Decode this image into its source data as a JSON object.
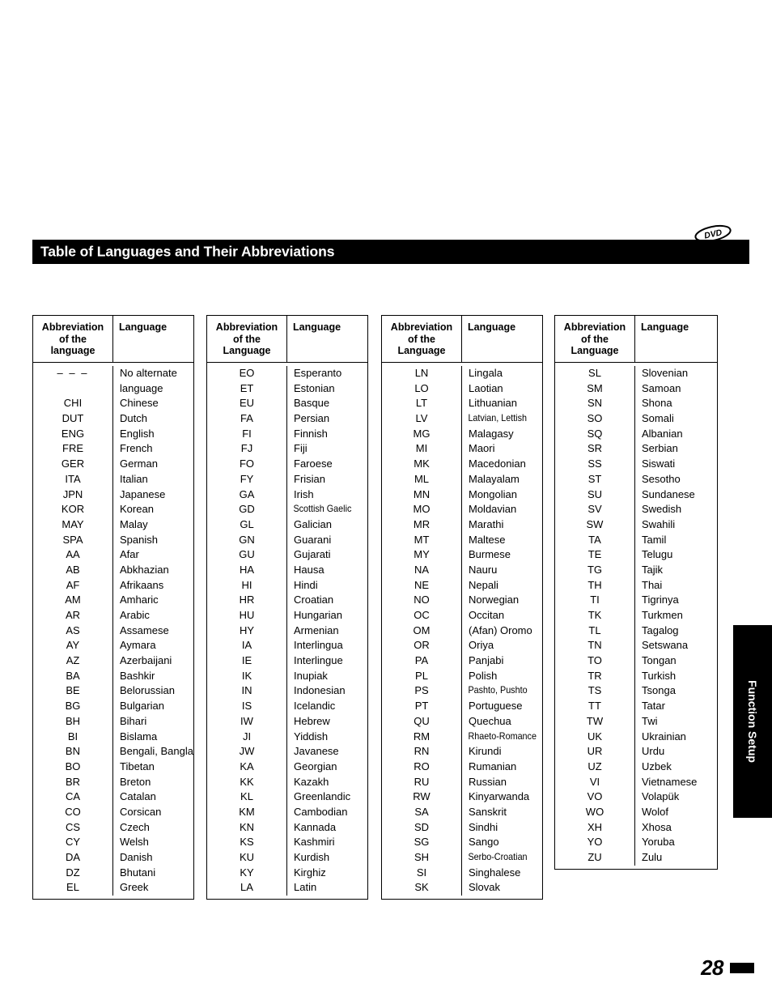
{
  "page": {
    "title": "Table of Languages and Their Abbreviations",
    "disc_badge": "DVD",
    "side_tab": "Function Setup",
    "page_number": "28"
  },
  "tables": [
    {
      "header": {
        "abbr": "Abbreviation\nof the\nlanguage",
        "lang": "Language"
      },
      "rows": [
        {
          "abbr": "– – –",
          "lang": "No alternate"
        },
        {
          "abbr": "",
          "lang": "language",
          "continuation": true
        },
        {
          "abbr": "CHI",
          "lang": "Chinese"
        },
        {
          "abbr": "DUT",
          "lang": "Dutch"
        },
        {
          "abbr": "ENG",
          "lang": "English"
        },
        {
          "abbr": "FRE",
          "lang": "French"
        },
        {
          "abbr": "GER",
          "lang": "German"
        },
        {
          "abbr": "ITA",
          "lang": "Italian"
        },
        {
          "abbr": "JPN",
          "lang": "Japanese"
        },
        {
          "abbr": "KOR",
          "lang": "Korean"
        },
        {
          "abbr": "MAY",
          "lang": "Malay"
        },
        {
          "abbr": "SPA",
          "lang": "Spanish"
        },
        {
          "abbr": "AA",
          "lang": "Afar"
        },
        {
          "abbr": "AB",
          "lang": "Abkhazian"
        },
        {
          "abbr": "AF",
          "lang": "Afrikaans"
        },
        {
          "abbr": "AM",
          "lang": "Amharic"
        },
        {
          "abbr": "AR",
          "lang": "Arabic"
        },
        {
          "abbr": "AS",
          "lang": "Assamese"
        },
        {
          "abbr": "AY",
          "lang": "Aymara"
        },
        {
          "abbr": "AZ",
          "lang": "Azerbaijani"
        },
        {
          "abbr": "BA",
          "lang": "Bashkir"
        },
        {
          "abbr": "BE",
          "lang": "Belorussian"
        },
        {
          "abbr": "BG",
          "lang": "Bulgarian"
        },
        {
          "abbr": "BH",
          "lang": "Bihari"
        },
        {
          "abbr": "BI",
          "lang": "Bislama"
        },
        {
          "abbr": "BN",
          "lang": "Bengali, Bangla"
        },
        {
          "abbr": "BO",
          "lang": "Tibetan"
        },
        {
          "abbr": "BR",
          "lang": "Breton"
        },
        {
          "abbr": "CA",
          "lang": "Catalan"
        },
        {
          "abbr": "CO",
          "lang": "Corsican"
        },
        {
          "abbr": "CS",
          "lang": "Czech"
        },
        {
          "abbr": "CY",
          "lang": "Welsh"
        },
        {
          "abbr": "DA",
          "lang": "Danish"
        },
        {
          "abbr": "DZ",
          "lang": "Bhutani"
        },
        {
          "abbr": "EL",
          "lang": "Greek"
        }
      ]
    },
    {
      "header": {
        "abbr": "Abbreviation\nof the\nLanguage",
        "lang": "Language"
      },
      "rows": [
        {
          "abbr": "EO",
          "lang": "Esperanto"
        },
        {
          "abbr": "ET",
          "lang": "Estonian"
        },
        {
          "abbr": "EU",
          "lang": "Basque"
        },
        {
          "abbr": "FA",
          "lang": "Persian"
        },
        {
          "abbr": "FI",
          "lang": "Finnish"
        },
        {
          "abbr": "FJ",
          "lang": "Fiji"
        },
        {
          "abbr": "FO",
          "lang": "Faroese"
        },
        {
          "abbr": "FY",
          "lang": "Frisian"
        },
        {
          "abbr": "GA",
          "lang": "Irish"
        },
        {
          "abbr": "GD",
          "lang": "Scottish Gaelic",
          "condensed": true
        },
        {
          "abbr": "GL",
          "lang": "Galician"
        },
        {
          "abbr": "GN",
          "lang": "Guarani"
        },
        {
          "abbr": "GU",
          "lang": "Gujarati"
        },
        {
          "abbr": "HA",
          "lang": "Hausa"
        },
        {
          "abbr": "HI",
          "lang": "Hindi"
        },
        {
          "abbr": "HR",
          "lang": "Croatian"
        },
        {
          "abbr": "HU",
          "lang": "Hungarian"
        },
        {
          "abbr": "HY",
          "lang": "Armenian"
        },
        {
          "abbr": "IA",
          "lang": "Interlingua"
        },
        {
          "abbr": "IE",
          "lang": "Interlingue"
        },
        {
          "abbr": "IK",
          "lang": "Inupiak"
        },
        {
          "abbr": "IN",
          "lang": "Indonesian"
        },
        {
          "abbr": "IS",
          "lang": "Icelandic"
        },
        {
          "abbr": "IW",
          "lang": "Hebrew"
        },
        {
          "abbr": "JI",
          "lang": "Yiddish"
        },
        {
          "abbr": "JW",
          "lang": "Javanese"
        },
        {
          "abbr": "KA",
          "lang": "Georgian"
        },
        {
          "abbr": "KK",
          "lang": "Kazakh"
        },
        {
          "abbr": "KL",
          "lang": "Greenlandic"
        },
        {
          "abbr": "KM",
          "lang": "Cambodian"
        },
        {
          "abbr": "KN",
          "lang": "Kannada"
        },
        {
          "abbr": "KS",
          "lang": "Kashmiri"
        },
        {
          "abbr": "KU",
          "lang": "Kurdish"
        },
        {
          "abbr": "KY",
          "lang": "Kirghiz"
        },
        {
          "abbr": "LA",
          "lang": "Latin"
        }
      ]
    },
    {
      "header": {
        "abbr": "Abbreviation\nof the\nLanguage",
        "lang": "Language"
      },
      "rows": [
        {
          "abbr": "LN",
          "lang": "Lingala"
        },
        {
          "abbr": "LO",
          "lang": "Laotian"
        },
        {
          "abbr": "LT",
          "lang": "Lithuanian"
        },
        {
          "abbr": "LV",
          "lang": "Latvian, Lettish",
          "condensed": true
        },
        {
          "abbr": "MG",
          "lang": "Malagasy"
        },
        {
          "abbr": "MI",
          "lang": "Maori"
        },
        {
          "abbr": "MK",
          "lang": "Macedonian"
        },
        {
          "abbr": "ML",
          "lang": "Malayalam"
        },
        {
          "abbr": "MN",
          "lang": "Mongolian"
        },
        {
          "abbr": "MO",
          "lang": "Moldavian"
        },
        {
          "abbr": "MR",
          "lang": "Marathi"
        },
        {
          "abbr": "MT",
          "lang": "Maltese"
        },
        {
          "abbr": "MY",
          "lang": "Burmese"
        },
        {
          "abbr": "NA",
          "lang": "Nauru"
        },
        {
          "abbr": "NE",
          "lang": "Nepali"
        },
        {
          "abbr": "NO",
          "lang": "Norwegian"
        },
        {
          "abbr": "OC",
          "lang": "Occitan"
        },
        {
          "abbr": "OM",
          "lang": "(Afan) Oromo"
        },
        {
          "abbr": "OR",
          "lang": "Oriya"
        },
        {
          "abbr": "PA",
          "lang": "Panjabi"
        },
        {
          "abbr": "PL",
          "lang": "Polish"
        },
        {
          "abbr": "PS",
          "lang": "Pashto, Pushto",
          "condensed": true
        },
        {
          "abbr": "PT",
          "lang": "Portuguese"
        },
        {
          "abbr": "QU",
          "lang": "Quechua"
        },
        {
          "abbr": "RM",
          "lang": "Rhaeto-Romance",
          "condensed": true
        },
        {
          "abbr": "RN",
          "lang": "Kirundi"
        },
        {
          "abbr": "RO",
          "lang": "Rumanian"
        },
        {
          "abbr": "RU",
          "lang": "Russian"
        },
        {
          "abbr": "RW",
          "lang": "Kinyarwanda"
        },
        {
          "abbr": "SA",
          "lang": "Sanskrit"
        },
        {
          "abbr": "SD",
          "lang": "Sindhi"
        },
        {
          "abbr": "SG",
          "lang": "Sango"
        },
        {
          "abbr": "SH",
          "lang": "Serbo-Croatian",
          "condensed": true
        },
        {
          "abbr": "SI",
          "lang": "Singhalese"
        },
        {
          "abbr": "SK",
          "lang": "Slovak"
        }
      ]
    },
    {
      "header": {
        "abbr": "Abbreviation\nof the\nLanguage",
        "lang": "Language"
      },
      "rows": [
        {
          "abbr": "SL",
          "lang": "Slovenian"
        },
        {
          "abbr": "SM",
          "lang": "Samoan"
        },
        {
          "abbr": "SN",
          "lang": "Shona"
        },
        {
          "abbr": "SO",
          "lang": "Somali"
        },
        {
          "abbr": "SQ",
          "lang": "Albanian"
        },
        {
          "abbr": "SR",
          "lang": "Serbian"
        },
        {
          "abbr": "SS",
          "lang": "Siswati"
        },
        {
          "abbr": "ST",
          "lang": "Sesotho"
        },
        {
          "abbr": "SU",
          "lang": "Sundanese"
        },
        {
          "abbr": "SV",
          "lang": "Swedish"
        },
        {
          "abbr": "SW",
          "lang": "Swahili"
        },
        {
          "abbr": "TA",
          "lang": "Tamil"
        },
        {
          "abbr": "TE",
          "lang": "Telugu"
        },
        {
          "abbr": "TG",
          "lang": "Tajik"
        },
        {
          "abbr": "TH",
          "lang": "Thai"
        },
        {
          "abbr": "TI",
          "lang": "Tigrinya"
        },
        {
          "abbr": "TK",
          "lang": "Turkmen"
        },
        {
          "abbr": "TL",
          "lang": "Tagalog"
        },
        {
          "abbr": "TN",
          "lang": "Setswana"
        },
        {
          "abbr": "TO",
          "lang": "Tongan"
        },
        {
          "abbr": "TR",
          "lang": "Turkish"
        },
        {
          "abbr": "TS",
          "lang": "Tsonga"
        },
        {
          "abbr": "TT",
          "lang": "Tatar"
        },
        {
          "abbr": "TW",
          "lang": "Twi"
        },
        {
          "abbr": "UK",
          "lang": "Ukrainian"
        },
        {
          "abbr": "UR",
          "lang": "Urdu"
        },
        {
          "abbr": "UZ",
          "lang": "Uzbek"
        },
        {
          "abbr": "VI",
          "lang": "Vietnamese"
        },
        {
          "abbr": "VO",
          "lang": "Volapük"
        },
        {
          "abbr": "WO",
          "lang": "Wolof"
        },
        {
          "abbr": "XH",
          "lang": "Xhosa"
        },
        {
          "abbr": "YO",
          "lang": "Yoruba"
        },
        {
          "abbr": "ZU",
          "lang": "Zulu"
        }
      ]
    }
  ]
}
